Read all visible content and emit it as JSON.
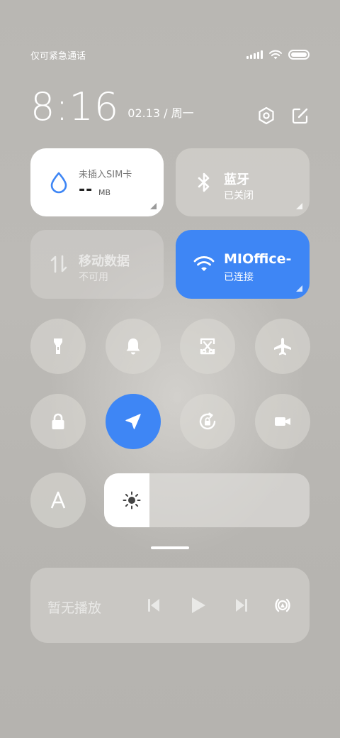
{
  "status_bar": {
    "carrier": "仅可紧急通话",
    "icons": [
      "signal-icon",
      "wifi-icon",
      "battery-icon"
    ]
  },
  "header": {
    "time": "8:16",
    "date": "02.13 / 周一",
    "actions": [
      "settings-icon",
      "edit-icon"
    ]
  },
  "tiles": {
    "data_usage": {
      "label": "未插入SIM卡",
      "value": "--",
      "unit": "MB",
      "icon": "water-drop-icon"
    },
    "bluetooth": {
      "title": "蓝牙",
      "status": "已关闭",
      "icon": "bluetooth-icon"
    },
    "mobile_data": {
      "title": "移动数据",
      "status": "不可用",
      "icon": "mobile-data-icon"
    },
    "wifi": {
      "title": "MIOffice-",
      "status": "已连接",
      "icon": "wifi-icon"
    }
  },
  "toggles": [
    {
      "name": "flashlight",
      "icon": "flashlight-icon",
      "active": false
    },
    {
      "name": "bell",
      "icon": "bell-icon",
      "active": false
    },
    {
      "name": "screenshot",
      "icon": "screenshot-icon",
      "active": false
    },
    {
      "name": "airplane",
      "icon": "airplane-icon",
      "active": false
    },
    {
      "name": "lock",
      "icon": "lock-icon",
      "active": false
    },
    {
      "name": "location",
      "icon": "location-icon",
      "active": true
    },
    {
      "name": "rotation",
      "icon": "rotation-lock-icon",
      "active": false
    },
    {
      "name": "video",
      "icon": "video-camera-icon",
      "active": false
    },
    {
      "name": "font",
      "icon": "font-a-icon",
      "active": false
    }
  ],
  "brightness": {
    "level_percent": 22,
    "icon": "sun-icon"
  },
  "media": {
    "label": "暂无播放",
    "controls": [
      "previous-icon",
      "play-icon",
      "next-icon",
      "cast-icon"
    ]
  },
  "colors": {
    "accent": "#3e86f5",
    "tile": "#dcdad6",
    "background": "#b8b6b2"
  }
}
